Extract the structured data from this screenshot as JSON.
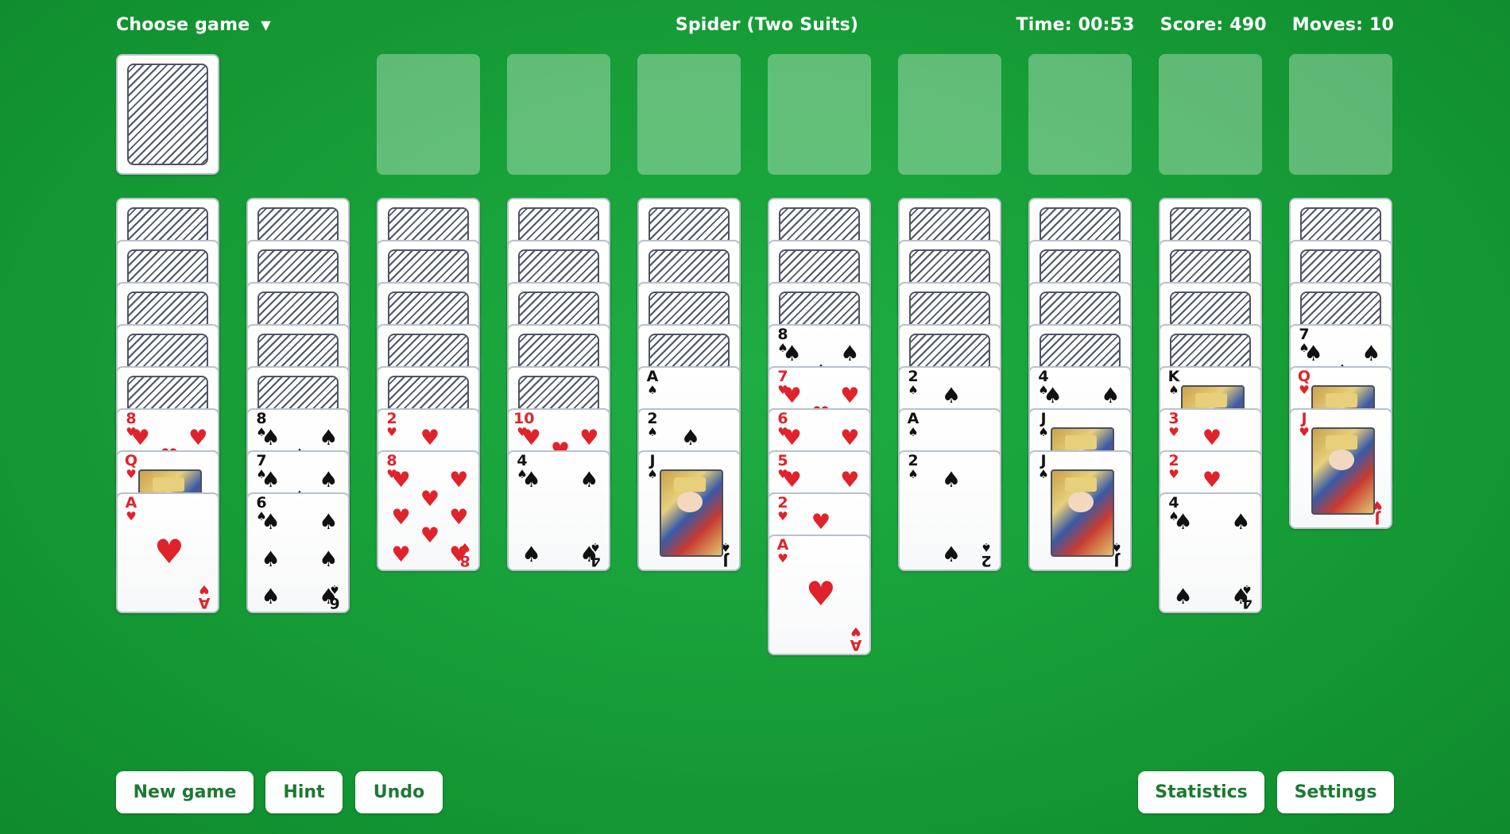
{
  "header": {
    "choose_game_label": "Choose game",
    "choose_game_caret": "▼",
    "title": "Spider (Two Suits)",
    "time": "Time: 00:53",
    "score": "Score: 490",
    "moves": "Moves: 10"
  },
  "footer": {
    "new_game_label": "New game",
    "hint_label": "Hint",
    "undo_label": "Undo",
    "statistics_label": "Statistics",
    "settings_label": "Settings"
  },
  "colors": {
    "felt": "#169c36",
    "red_suit": "#e0232a",
    "black_suit": "#111111",
    "button_text": "#1a7a31"
  },
  "stock": {
    "face_down_cards": 1
  },
  "foundations": {
    "empty_slots": 8
  },
  "tableau": [
    {
      "face_down": 5,
      "face_up": [
        {
          "rank": "8",
          "suit": "hearts"
        },
        {
          "rank": "Q",
          "suit": "hearts"
        },
        {
          "rank": "A",
          "suit": "hearts"
        }
      ]
    },
    {
      "face_down": 5,
      "face_up": [
        {
          "rank": "8",
          "suit": "spades"
        },
        {
          "rank": "7",
          "suit": "spades"
        },
        {
          "rank": "6",
          "suit": "spades"
        }
      ]
    },
    {
      "face_down": 5,
      "face_up": [
        {
          "rank": "2",
          "suit": "hearts"
        },
        {
          "rank": "8",
          "suit": "hearts"
        }
      ]
    },
    {
      "face_down": 5,
      "face_up": [
        {
          "rank": "10",
          "suit": "hearts"
        },
        {
          "rank": "4",
          "suit": "spades"
        }
      ]
    },
    {
      "face_down": 4,
      "face_up": [
        {
          "rank": "A",
          "suit": "spades"
        },
        {
          "rank": "2",
          "suit": "spades"
        },
        {
          "rank": "J",
          "suit": "spades"
        }
      ]
    },
    {
      "face_down": 3,
      "face_up": [
        {
          "rank": "8",
          "suit": "spades"
        },
        {
          "rank": "7",
          "suit": "hearts"
        },
        {
          "rank": "6",
          "suit": "hearts"
        },
        {
          "rank": "5",
          "suit": "hearts"
        },
        {
          "rank": "2",
          "suit": "hearts"
        },
        {
          "rank": "A",
          "suit": "hearts"
        }
      ]
    },
    {
      "face_down": 4,
      "face_up": [
        {
          "rank": "2",
          "suit": "spades"
        },
        {
          "rank": "A",
          "suit": "spades"
        },
        {
          "rank": "2",
          "suit": "spades"
        }
      ]
    },
    {
      "face_down": 4,
      "face_up": [
        {
          "rank": "4",
          "suit": "spades"
        },
        {
          "rank": "J",
          "suit": "spades"
        },
        {
          "rank": "J",
          "suit": "spades"
        }
      ]
    },
    {
      "face_down": 4,
      "face_up": [
        {
          "rank": "K",
          "suit": "spades"
        },
        {
          "rank": "3",
          "suit": "hearts"
        },
        {
          "rank": "2",
          "suit": "hearts"
        },
        {
          "rank": "4",
          "suit": "spades"
        }
      ]
    },
    {
      "face_down": 3,
      "face_up": [
        {
          "rank": "7",
          "suit": "spades"
        },
        {
          "rank": "Q",
          "suit": "hearts"
        },
        {
          "rank": "J",
          "suit": "hearts"
        }
      ]
    }
  ]
}
